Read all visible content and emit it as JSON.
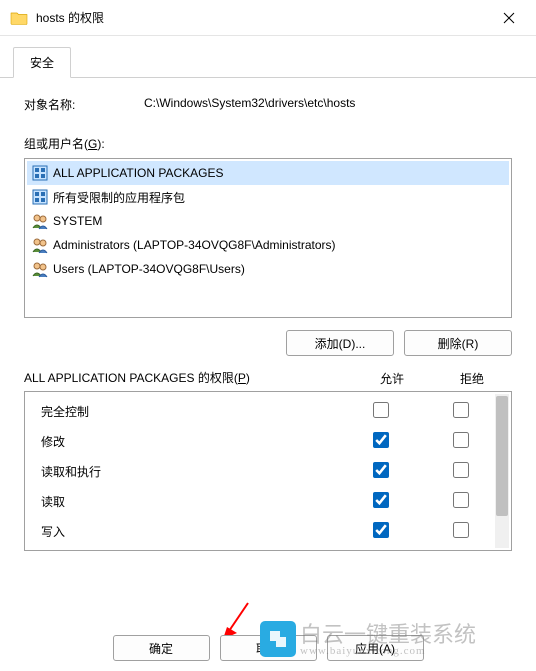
{
  "window": {
    "title": "hosts 的权限"
  },
  "tabs": {
    "security": "安全"
  },
  "object": {
    "label": "对象名称:",
    "value": "C:\\Windows\\System32\\drivers\\etc\\hosts"
  },
  "groups": {
    "label_pre": "组或用户名(",
    "label_key": "G",
    "label_post": "):",
    "items": [
      {
        "name": "ALL APPLICATION PACKAGES",
        "icon": "pkg",
        "selected": true
      },
      {
        "name": "所有受限制的应用程序包",
        "icon": "pkg",
        "selected": false
      },
      {
        "name": "SYSTEM",
        "icon": "users",
        "selected": false
      },
      {
        "name": "Administrators (LAPTOP-34OVQG8F\\Administrators)",
        "icon": "users",
        "selected": false
      },
      {
        "name": "Users (LAPTOP-34OVQG8F\\Users)",
        "icon": "users",
        "selected": false
      }
    ]
  },
  "buttons": {
    "add": "添加(D)...",
    "remove": "删除(R)",
    "ok": "确定",
    "cancel": "取消",
    "apply": "应用(A)"
  },
  "perms": {
    "header_for": "ALL APPLICATION PACKAGES 的权限(",
    "header_key": "P",
    "header_post": ")",
    "col_allow": "允许",
    "col_deny": "拒绝",
    "rows": [
      {
        "name": "完全控制",
        "allow": false,
        "deny": false
      },
      {
        "name": "修改",
        "allow": true,
        "deny": false
      },
      {
        "name": "读取和执行",
        "allow": true,
        "deny": false
      },
      {
        "name": "读取",
        "allow": true,
        "deny": false
      },
      {
        "name": "写入",
        "allow": true,
        "deny": false
      }
    ]
  },
  "watermark": {
    "line1": "白云一键重装系统",
    "line2": "www.baiyunxitong.com"
  }
}
